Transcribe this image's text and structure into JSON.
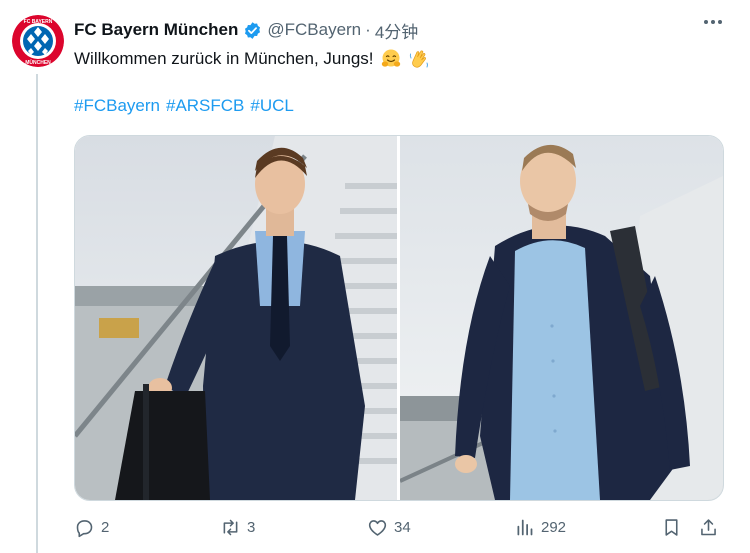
{
  "tweet": {
    "author_name": "FC Bayern München",
    "handle": "@FCBayern",
    "separator": "·",
    "time": "4分钟",
    "text": "Willkommen zurück in München, Jungs!",
    "emojis": [
      "hugging-face",
      "waving-hand"
    ],
    "hashtags": [
      "#FCBayern",
      "#ARSFCB",
      "#UCL"
    ],
    "verified_color": "#1d9bf0",
    "link_color": "#1d9bf0",
    "avatar": {
      "logo_text_top": "FC BAYERN",
      "logo_text_bottom": "MÜNCHEN",
      "colors": [
        "#dc052d",
        "#0066b2",
        "#ffffff"
      ]
    }
  },
  "media": {
    "images": [
      {
        "description_icon": "photo-player-suit-stairs"
      },
      {
        "description_icon": "photo-player-shirt-backpack"
      }
    ]
  },
  "actions": {
    "replies": "2",
    "reposts": "3",
    "likes": "34",
    "views": "292"
  },
  "colors": {
    "text": "#0f1419",
    "secondary": "#536471",
    "border": "#cfd9de"
  }
}
